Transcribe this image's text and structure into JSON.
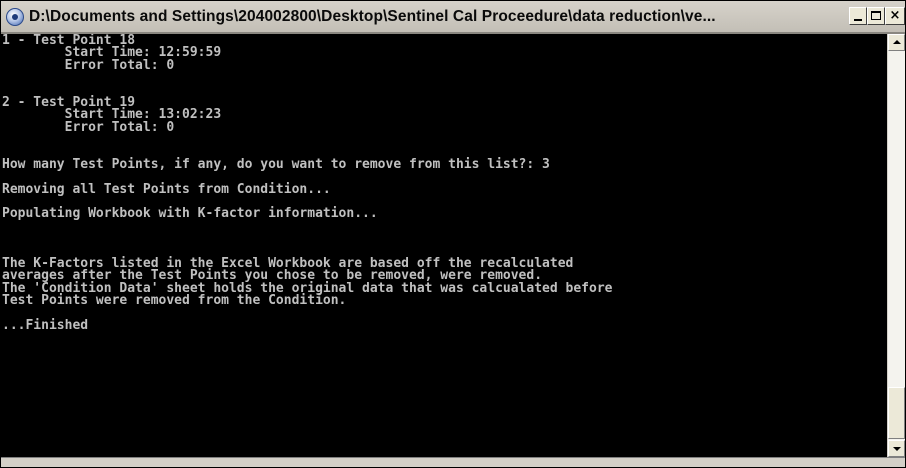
{
  "window": {
    "title": "D:\\Documents and Settings\\204002800\\Desktop\\Sentinel Cal Proceedure\\data reduction\\ve...",
    "minimize_label": "",
    "maximize_label": "",
    "close_label": "×",
    "icon": "console-app-icon"
  },
  "console": {
    "lines": [
      "1 - Test Point 18",
      "        Start Time: 12:59:59",
      "        Error Total: 0",
      "",
      "",
      "2 - Test Point 19",
      "        Start Time: 13:02:23",
      "        Error Total: 0",
      "",
      "",
      "How many Test Points, if any, do you want to remove from this list?: 3",
      "",
      "Removing all Test Points from Condition...",
      "",
      "Populating Workbook with K-factor information...",
      "",
      "",
      "",
      "The K-Factors listed in the Excel Workbook are based off the recalculated",
      "averages after the Test Points you chose to be removed, were removed.",
      "The 'Condition Data' sheet holds the original data that was calcualated before",
      "Test Points were removed from the Condition.",
      "",
      "...Finished",
      ""
    ]
  },
  "scrollbar": {
    "up_icon": "triangle-up-icon",
    "down_icon": "triangle-down-icon",
    "position_fraction": 1.0
  },
  "colors": {
    "console_bg": "#000000",
    "console_fg": "#c0c0c0",
    "titlebar_bg": "#c8c4bc"
  }
}
